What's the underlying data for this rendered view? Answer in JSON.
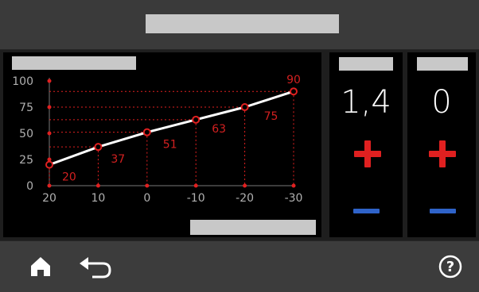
{
  "colors": {
    "accent_red": "#e02020",
    "minus_blue": "#2f63c9",
    "curve": "#ffffff",
    "label_placeholder": "#c8c8c8"
  },
  "icons": {
    "home": "home-icon",
    "back": "back-arrow-icon",
    "help": "help-icon",
    "increase": "plus-icon",
    "decrease": "minus-icon"
  },
  "panels": [
    {
      "value": "1,4"
    },
    {
      "value": "0"
    }
  ],
  "chart_data": {
    "type": "line",
    "x": [
      20,
      10,
      0,
      -10,
      -20,
      -30
    ],
    "y": [
      20,
      37,
      51,
      63,
      75,
      90
    ],
    "x_tick_labels": [
      "20",
      "10",
      "0",
      "-10",
      "-20",
      "-30"
    ],
    "y_tick_labels": [
      "0",
      "25",
      "50",
      "75",
      "100"
    ],
    "point_labels": [
      "20",
      "37",
      "51",
      "63",
      "75",
      "90"
    ],
    "xlim": [
      20,
      -30
    ],
    "ylim": [
      0,
      100
    ],
    "guide_lines": "dotted",
    "grid": false
  }
}
